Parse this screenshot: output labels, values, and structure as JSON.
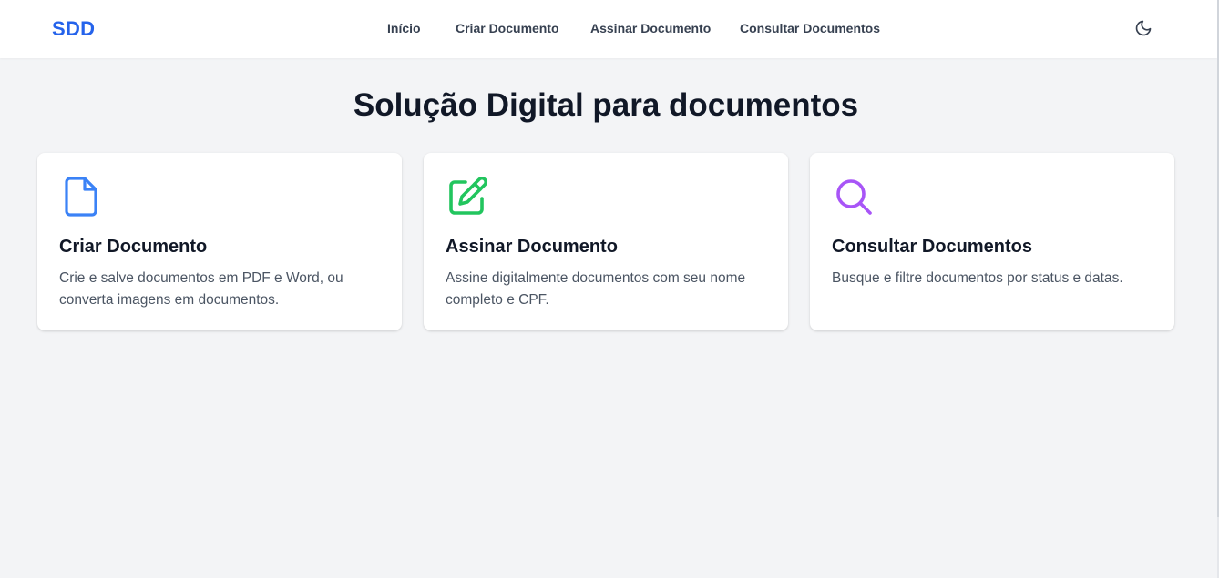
{
  "header": {
    "brand": "SDD",
    "nav": [
      {
        "label": "Início"
      },
      {
        "label": "Criar Documento"
      },
      {
        "label": "Assinar Documento"
      },
      {
        "label": "Consultar Documentos"
      }
    ],
    "theme_toggle_icon": "moon-icon"
  },
  "main": {
    "title": "Solução Digital para documentos",
    "cards": [
      {
        "title": "Criar Documento",
        "description": "Crie e salve documentos em PDF e Word, ou converta imagens em documentos.",
        "icon": "document-icon",
        "icon_color": "#3b82f6"
      },
      {
        "title": "Assinar Documento",
        "description": "Assine digitalmente documentos com seu nome completo e CPF.",
        "icon": "pencil-square-icon",
        "icon_color": "#22c55e"
      },
      {
        "title": "Consultar Documentos",
        "description": "Busque e filtre documentos por status e datas.",
        "icon": "search-icon",
        "icon_color": "#a855f7"
      }
    ]
  },
  "colors": {
    "brand": "#2563eb",
    "background": "#f3f4f6",
    "card": "#ffffff"
  }
}
